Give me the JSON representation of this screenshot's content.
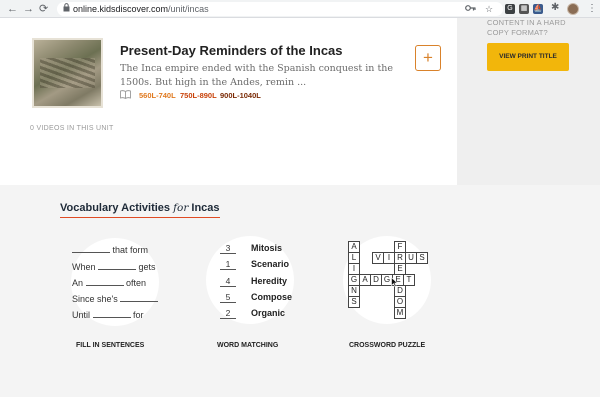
{
  "browser": {
    "back": "←",
    "forward": "→",
    "reload": "⟳",
    "lock": "🔒",
    "url_domain": "online.kidsdiscover.com",
    "url_path": "/unit/incas",
    "icons": [
      "key-icon",
      "star-icon",
      "extension-icon",
      "puzzle-icon"
    ],
    "menu": "⋮"
  },
  "lesson": {
    "title": "Present-Day Reminders of the Incas",
    "description": "The Inca empire ended with the Spanish conquest in the 1500s. But high in the Andes, remin ...",
    "book_icon": "📖",
    "lexile": [
      {
        "label": "560L-740L",
        "color": "#e07a20"
      },
      {
        "label": "750L-890L",
        "color": "#c8420a"
      },
      {
        "label": "900L-1040L",
        "color": "#7a2a05"
      }
    ],
    "add_label": "+",
    "videos_count": "0 VIDEOS IN THIS UNIT"
  },
  "sidebar": {
    "text": "CONTENT IN A HARD COPY FORMAT?",
    "print_button": "VIEW PRINT TITLE",
    "accent": "#f2b60b"
  },
  "vocab": {
    "heading_pre": "Vocabulary Activities ",
    "heading_for": "for",
    "heading_post": " Incas",
    "underline_color": "#e04b24",
    "fill_sentences": [
      {
        "before": "",
        "after": " that form"
      },
      {
        "before": "When ",
        "after": " gets"
      },
      {
        "before": "An ",
        "after": " often"
      },
      {
        "before": "Since she's ",
        "after": ""
      },
      {
        "before": "Until ",
        "after": " for"
      }
    ],
    "matching": [
      {
        "num": "3",
        "word": "Mitosis"
      },
      {
        "num": "1",
        "word": "Scenario"
      },
      {
        "num": "4",
        "word": "Heredity"
      },
      {
        "num": "5",
        "word": "Compose"
      },
      {
        "num": "2",
        "word": "Organic"
      }
    ],
    "crossword": {
      "col1": [
        "A",
        "L",
        "I",
        "G",
        "N",
        "S"
      ],
      "virus": [
        "V",
        "I",
        "R",
        "U",
        "S"
      ],
      "gadget": [
        "A",
        "D",
        "G",
        "E",
        "T"
      ],
      "col_f": [
        "F",
        "",
        "E",
        "",
        "D",
        "O",
        "M"
      ]
    },
    "captions": [
      "FILL IN SENTENCES",
      "WORD MATCHING",
      "CROSSWORD PUZZLE"
    ]
  }
}
